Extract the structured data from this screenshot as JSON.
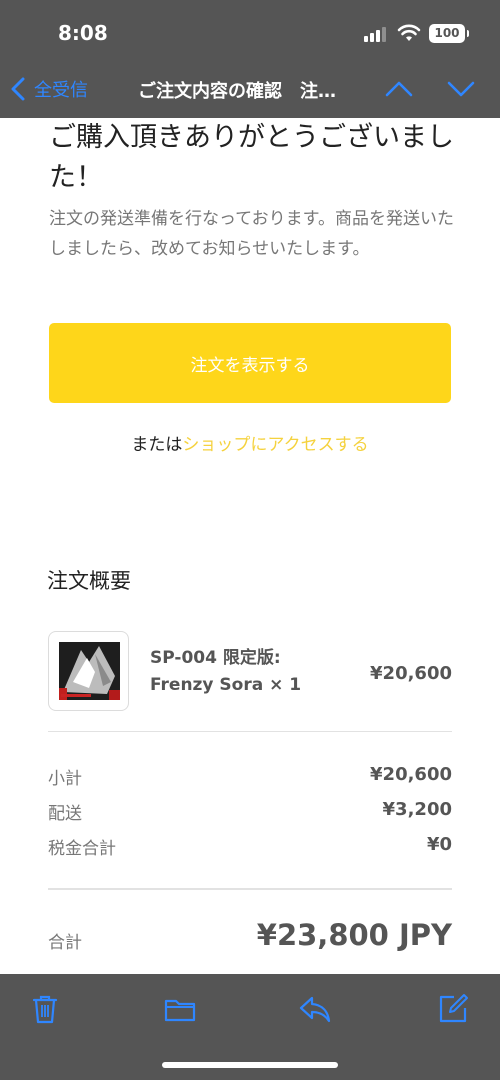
{
  "status": {
    "time": "8:08",
    "battery": "100"
  },
  "nav": {
    "back_label": "全受信",
    "title": "ご注文内容の確認　注…"
  },
  "message": {
    "thanks": "ご購入頂きありがとうございました！",
    "description": "注文の発送準備を行なっております。商品を発送いたしましたら、改めてお知らせいたします。",
    "view_order_button": "注文を表示する",
    "or_text": "または",
    "shop_link": "ショップにアクセスする"
  },
  "summary": {
    "title": "注文概要",
    "item": {
      "name": "SP-004 限定版: Frenzy Sora × 1",
      "price": "¥20,600"
    },
    "rows": [
      {
        "label": "小計",
        "value": "¥20,600"
      },
      {
        "label": "配送",
        "value": "¥3,200"
      },
      {
        "label": "税金合計",
        "value": "¥0"
      }
    ],
    "total_label": "合計",
    "total_value": "¥23,800 JPY"
  },
  "toolbar": {
    "icons": [
      "trash-icon",
      "folder-icon",
      "reply-icon",
      "compose-icon"
    ]
  },
  "colors": {
    "accent_blue": "#2f86ff",
    "button_yellow": "#fed61a",
    "link_yellow": "#f5d23e",
    "overlay_gray": "#555555"
  }
}
